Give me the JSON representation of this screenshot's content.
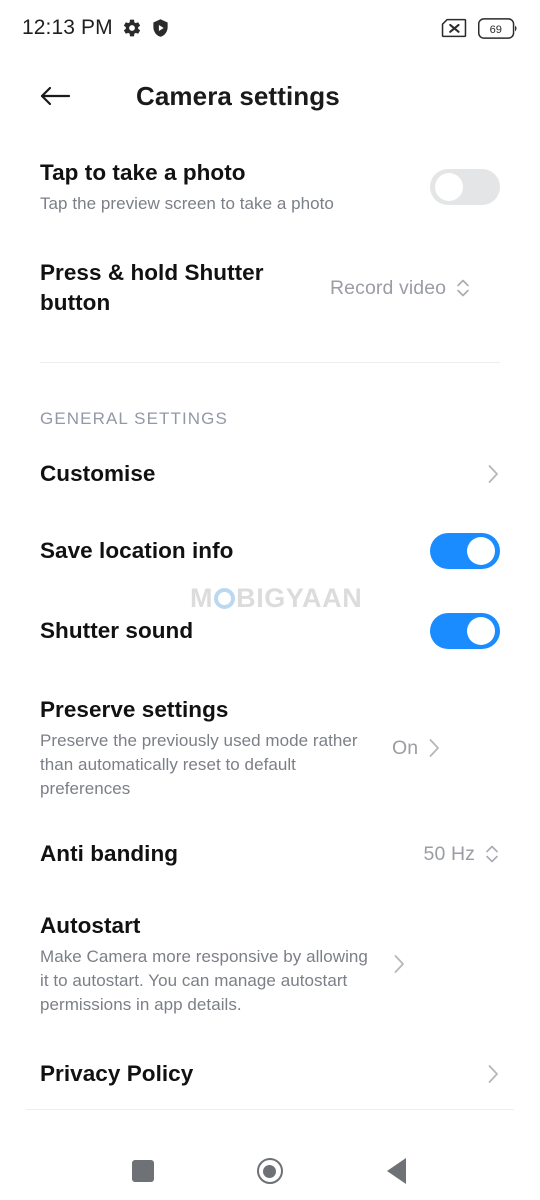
{
  "status_bar": {
    "time": "12:13 PM",
    "left_icons": [
      "gear-icon",
      "shield-play-icon"
    ],
    "right_icons": [
      "sim-off-icon"
    ],
    "battery_level": "69"
  },
  "header": {
    "back_icon": "arrow-left-icon",
    "title": "Camera settings"
  },
  "settings": {
    "tap_to_take_photo": {
      "title": "Tap to take a photo",
      "subtitle": "Tap the preview screen to take a photo",
      "toggle_state": "off"
    },
    "press_hold_shutter": {
      "title": "Press & hold Shutter button",
      "value": "Record video",
      "control_icon": "chevron-updown-icon"
    },
    "section_general": "GENERAL SETTINGS",
    "customise": {
      "title": "Customise",
      "control_icon": "chevron-right-icon"
    },
    "save_location": {
      "title": "Save location info",
      "toggle_state": "on"
    },
    "shutter_sound": {
      "title": "Shutter sound",
      "toggle_state": "on"
    },
    "preserve_settings": {
      "title": "Preserve settings",
      "subtitle": "Preserve the previously used mode rather than automatically reset to default preferences",
      "value": "On",
      "control_icon": "chevron-right-icon"
    },
    "anti_banding": {
      "title": "Anti banding",
      "value": "50 Hz",
      "control_icon": "chevron-updown-icon"
    },
    "autostart": {
      "title": "Autostart",
      "subtitle": "Make Camera more responsive by allowing it to autostart. You can manage autostart permissions in app details.",
      "control_icon": "chevron-right-icon"
    },
    "privacy_policy": {
      "title": "Privacy Policy",
      "control_icon": "chevron-right-icon"
    }
  },
  "watermark": {
    "part1": "M",
    "part2": "BIGYAAN"
  },
  "nav_bar": {
    "recents_label": "recents-button",
    "home_label": "home-button",
    "back_label": "back-button"
  },
  "colors": {
    "toggle_on": "#1a8cff",
    "toggle_off": "#e3e5e7",
    "title_text": "#111111",
    "sub_text": "#7b7f86",
    "section_text": "#9199a6"
  }
}
